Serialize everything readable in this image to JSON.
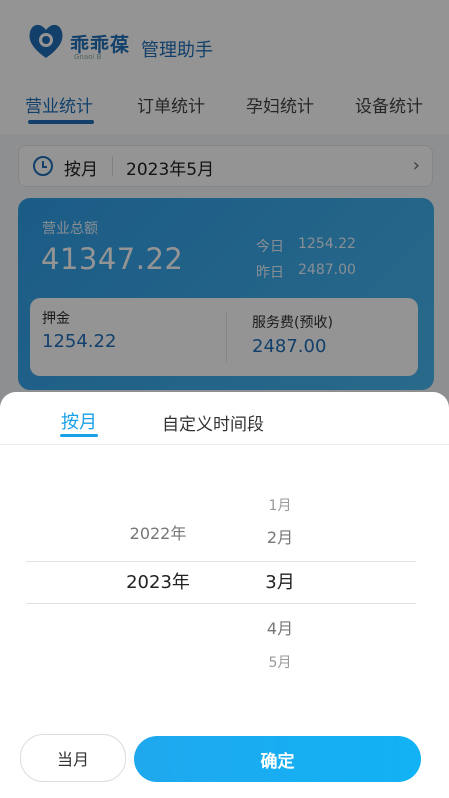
{
  "app": {
    "brand_text": "乖乖葆",
    "brand_sub": "Gnaoi B",
    "title": "管理助手"
  },
  "tabs": [
    "营业统计",
    "订单统计",
    "孕妇统计",
    "设备统计"
  ],
  "date_bar": {
    "mode": "按月",
    "value": "2023年5月"
  },
  "revenue": {
    "label": "营业总额",
    "total": "41347.22",
    "today_label": "今日",
    "today_value": "1254.22",
    "yesterday_label": "昨日",
    "yesterday_value": "2487.00",
    "deposit_label": "押金",
    "deposit_value": "1254.22",
    "fee_label": "服务费(预收)",
    "fee_value": "2487.00"
  },
  "sheet": {
    "tab_month": "按月",
    "tab_custom": "自定义时间段",
    "years": [
      "2022年",
      "2023年"
    ],
    "months": [
      "1月",
      "2月",
      "3月",
      "4月",
      "5月"
    ],
    "selected_year": "2023年",
    "selected_month": "3月",
    "btn_current": "当月",
    "btn_confirm": "确定"
  },
  "colors": {
    "primary": "#1f6fb8",
    "accent": "#1aa0e8",
    "card_gradient_start": "#2f9ee8"
  }
}
